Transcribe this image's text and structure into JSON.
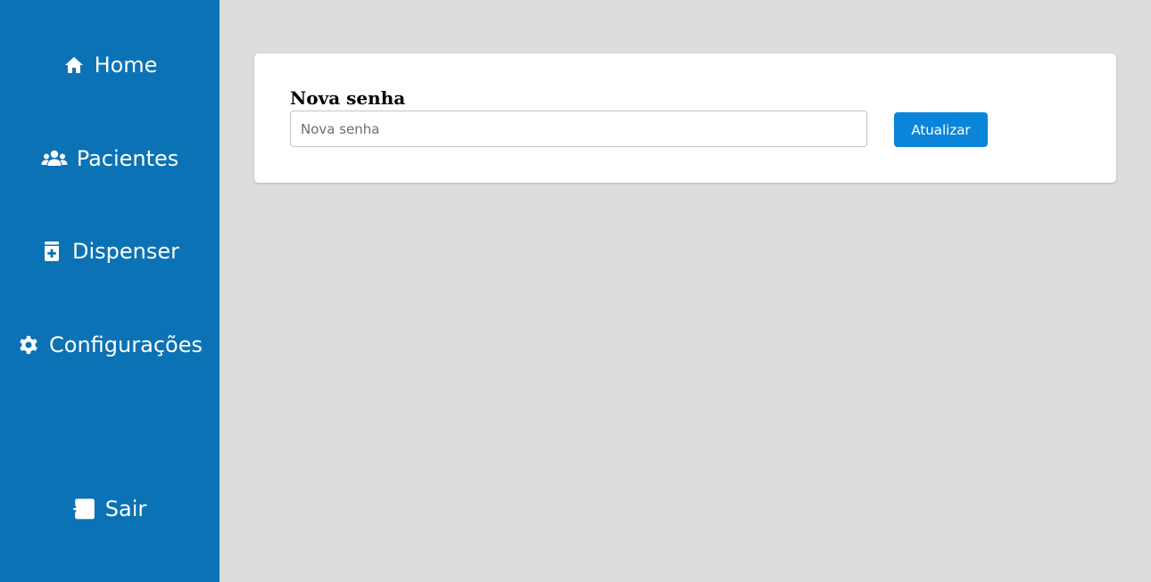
{
  "sidebar": {
    "background": "#0b72b5",
    "items": [
      {
        "label": "Home",
        "icon": "home-icon"
      },
      {
        "label": "Pacientes",
        "icon": "users-icon"
      },
      {
        "label": "Dispenser",
        "icon": "medicine-bottle-icon"
      },
      {
        "label": "Configurações",
        "icon": "gear-icon"
      }
    ],
    "logout": {
      "label": "Sair",
      "icon": "logout-icon"
    }
  },
  "main": {
    "background": "#dddddd",
    "form": {
      "title": "Nova senha",
      "input": {
        "placeholder": "Nova senha",
        "value": ""
      },
      "submit_label": "Atualizar",
      "accent": "#0a85d9"
    }
  }
}
